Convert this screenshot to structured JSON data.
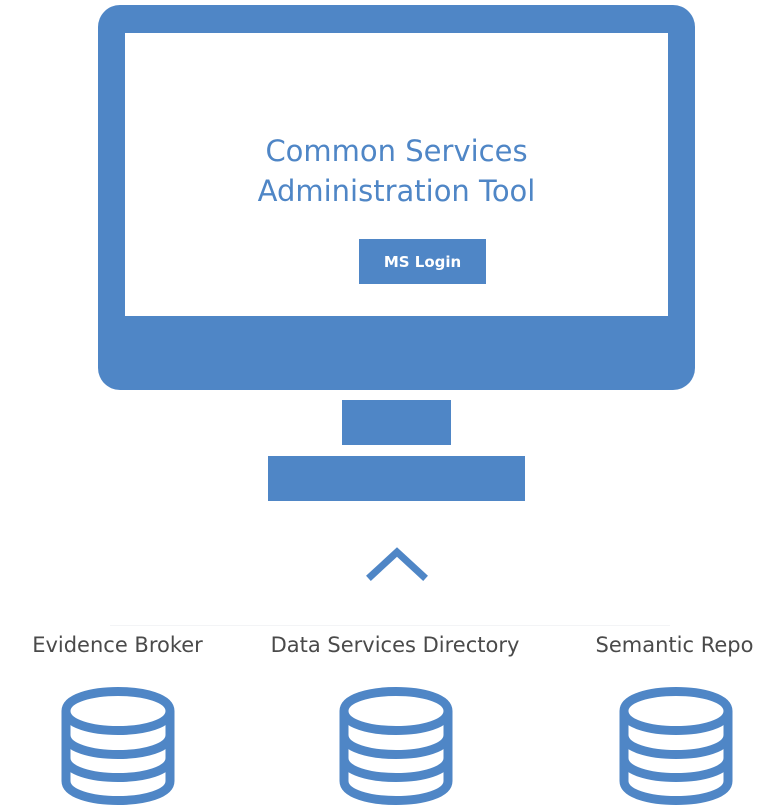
{
  "app": {
    "title_line1": "Common Services",
    "title_line2": "Administration Tool",
    "login_button": "MS Login"
  },
  "services": [
    {
      "label": "Evidence Broker",
      "icon": "database-icon"
    },
    {
      "label": "Data Services Directory",
      "icon": "database-icon"
    },
    {
      "label": "Semantic Repo",
      "icon": "database-icon"
    }
  ],
  "connector_icon": "chevron-up-icon",
  "colors": {
    "accent": "#4f86c6",
    "label_text": "#4a4a4a",
    "background": "#ffffff"
  }
}
